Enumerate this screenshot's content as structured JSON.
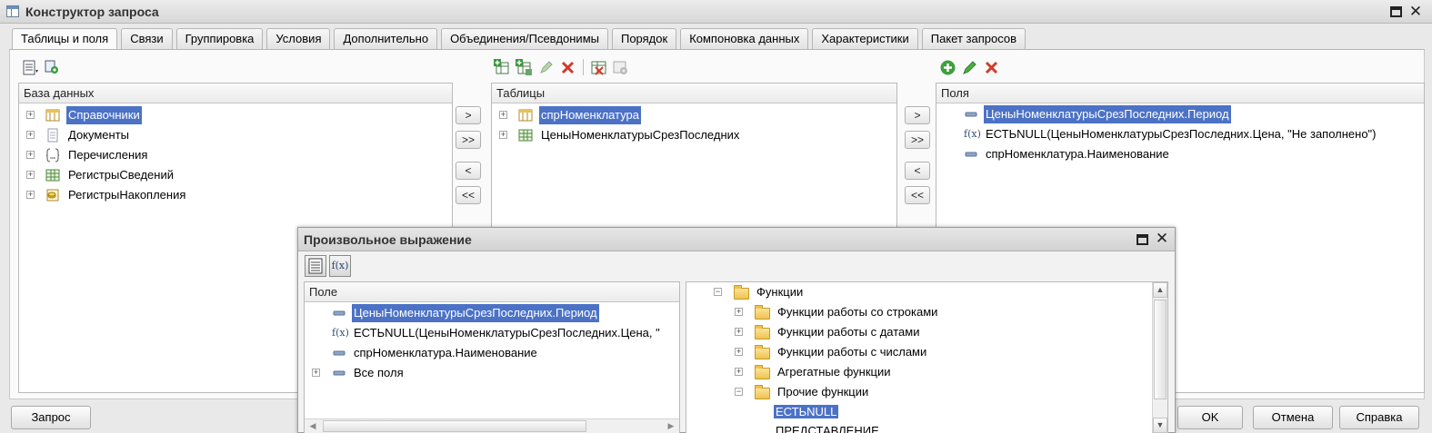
{
  "window": {
    "title": "Конструктор запроса"
  },
  "tabs": [
    {
      "label": "Таблицы и поля"
    },
    {
      "label": "Связи"
    },
    {
      "label": "Группировка"
    },
    {
      "label": "Условия"
    },
    {
      "label": "Дополнительно"
    },
    {
      "label": "Объединения/Псевдонимы"
    },
    {
      "label": "Порядок"
    },
    {
      "label": "Компоновка данных"
    },
    {
      "label": "Характеристики"
    },
    {
      "label": "Пакет запросов"
    }
  ],
  "database_panel": {
    "header": "База данных",
    "items": [
      {
        "label": "Справочники",
        "icon": "catalog-icon"
      },
      {
        "label": "Документы",
        "icon": "document-icon"
      },
      {
        "label": "Перечисления",
        "icon": "enum-icon"
      },
      {
        "label": "РегистрыСведений",
        "icon": "info-register-icon"
      },
      {
        "label": "РегистрыНакопления",
        "icon": "accumulation-register-icon"
      }
    ]
  },
  "move_buttons": {
    "add": ">",
    "add_all": ">>",
    "remove": "<",
    "remove_all": "<<"
  },
  "tables_panel": {
    "header": "Таблицы",
    "items": [
      {
        "label": "спрНоменклатура"
      },
      {
        "label": "ЦеныНоменклатурыСрезПоследних"
      }
    ]
  },
  "fields_panel": {
    "header": "Поля",
    "items": [
      {
        "label": "ЦеныНоменклатурыСрезПоследних.Период"
      },
      {
        "label": "ЕСТЬNULL(ЦеныНоменклатурыСрезПоследних.Цена, \"Не заполнено\")"
      },
      {
        "label": "спрНоменклатура.Наименование"
      }
    ]
  },
  "dialog": {
    "title": "Произвольное выражение",
    "field_panel": {
      "header": "Поле",
      "items": [
        {
          "label": "ЦеныНоменклатурыСрезПоследних.Период"
        },
        {
          "label": "ЕСТЬNULL(ЦеныНоменклатурыСрезПоследних.Цена, \""
        },
        {
          "label": "спрНоменклатура.Наименование"
        },
        {
          "label": "Все поля"
        }
      ]
    },
    "functions_tree": {
      "root": "Функции",
      "items": [
        {
          "label": "Функции работы со строками"
        },
        {
          "label": "Функции работы с датами"
        },
        {
          "label": "Функции работы с числами"
        },
        {
          "label": "Агрегатные функции"
        },
        {
          "label": "Прочие функции"
        }
      ],
      "leaves": [
        {
          "label": "ЕСТЬNULL"
        },
        {
          "label": "ПРЕДСТАВЛЕНИЕ"
        }
      ]
    }
  },
  "buttons": {
    "query": "Запрос",
    "ok": "OK",
    "cancel": "Отмена",
    "help": "Справка"
  },
  "colors": {
    "selection": "#4c72c6",
    "accent_green": "#3a9a3a",
    "accent_red": "#d23a2a"
  }
}
